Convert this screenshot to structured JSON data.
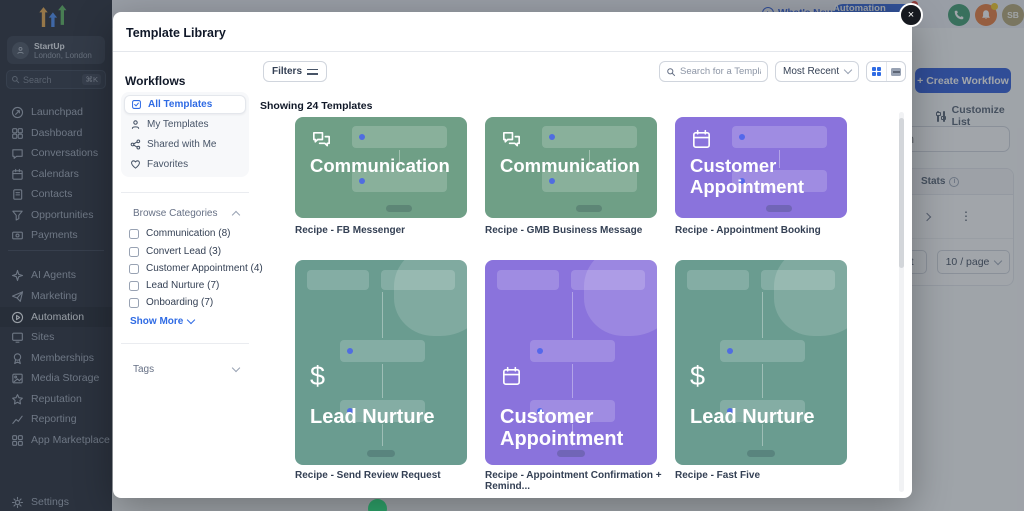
{
  "app": {
    "account": {
      "name": "StartUp",
      "location": "London, London"
    },
    "sidebar_search": {
      "placeholder": "Search",
      "shortcut": "⌘K"
    },
    "nav": [
      {
        "label": "Launchpad",
        "icon": "launchpad-icon"
      },
      {
        "label": "Dashboard",
        "icon": "dashboard-icon"
      },
      {
        "label": "Conversations",
        "icon": "conversations-icon"
      },
      {
        "label": "Calendars",
        "icon": "calendar-icon"
      },
      {
        "label": "Contacts",
        "icon": "contacts-icon"
      },
      {
        "label": "Opportunities",
        "icon": "opportunities-icon"
      },
      {
        "label": "Payments",
        "icon": "payments-icon"
      },
      {
        "label": "AI Agents",
        "icon": "ai-agents-icon"
      },
      {
        "label": "Marketing",
        "icon": "marketing-icon"
      },
      {
        "label": "Automation",
        "icon": "automation-icon",
        "active": true
      },
      {
        "label": "Sites",
        "icon": "sites-icon"
      },
      {
        "label": "Memberships",
        "icon": "memberships-icon"
      },
      {
        "label": "Media Storage",
        "icon": "media-storage-icon"
      },
      {
        "label": "Reputation",
        "icon": "reputation-icon"
      },
      {
        "label": "Reporting",
        "icon": "reporting-icon"
      },
      {
        "label": "App Marketplace",
        "icon": "app-marketplace-icon"
      }
    ],
    "settings_label": "Settings",
    "topbar": {
      "whats_new": "What's New",
      "automation_updates": "Automation Updates",
      "avatar_initials": "SB"
    },
    "page": {
      "create_workflow_label": "+  Create Workflow",
      "customize_list_label": "Customize List",
      "search_placeholder": "Search",
      "stats_header": "Stats",
      "next_label": "Next",
      "page_size": "10 / page"
    }
  },
  "modal": {
    "title": "Template Library",
    "section_title": "Workflows",
    "nav": [
      {
        "label": "All Templates",
        "icon": "checkbox-checked-icon",
        "active": true
      },
      {
        "label": "My Templates",
        "icon": "user-icon"
      },
      {
        "label": "Shared with Me",
        "icon": "share-icon"
      },
      {
        "label": "Favorites",
        "icon": "heart-icon"
      }
    ],
    "browse": {
      "title": "Browse Categories",
      "items": [
        {
          "label": "Communication (8)"
        },
        {
          "label": "Convert Lead (3)"
        },
        {
          "label": "Customer Appointment (4)"
        },
        {
          "label": "Lead Nurture (7)"
        },
        {
          "label": "Onboarding (7)"
        }
      ],
      "show_more_label": "Show More"
    },
    "tags_label": "Tags",
    "toolbar": {
      "filters_label": "Filters",
      "showing_text": "Showing 24 Templates",
      "search_placeholder": "Search for a Template",
      "sort_value": "Most Recent"
    },
    "cards": [
      {
        "category": "Communication",
        "label": "Recipe - FB Messenger",
        "icon": "chat-icon",
        "color": "#6f9f86"
      },
      {
        "category": "Communication",
        "label": "Recipe - GMB Business Message",
        "icon": "chat-icon",
        "color": "#6f9f86"
      },
      {
        "category": "Customer Appointment",
        "label": "Recipe - Appointment Booking",
        "icon": "calendar-icon",
        "color": "#8a73dc"
      },
      {
        "category": "Lead Nurture",
        "label": "Recipe - Send Review Request",
        "icon": "dollar-icon",
        "color": "#6a9c90"
      },
      {
        "category": "Customer Appointment",
        "label": "Recipe - Appointment Confirmation + Remind...",
        "icon": "calendar-icon",
        "color": "#8a73dc"
      },
      {
        "category": "Lead Nurture",
        "label": "Recipe - Fast Five",
        "icon": "dollar-icon",
        "color": "#6a9c90"
      }
    ]
  },
  "colors": {
    "accent_blue": "#1e56d8",
    "link_blue": "#2f6be4",
    "card_green": "#6f9f86",
    "card_teal": "#6a9c90",
    "card_purple": "#8a73dc",
    "sidebar_bg": "#121826"
  }
}
